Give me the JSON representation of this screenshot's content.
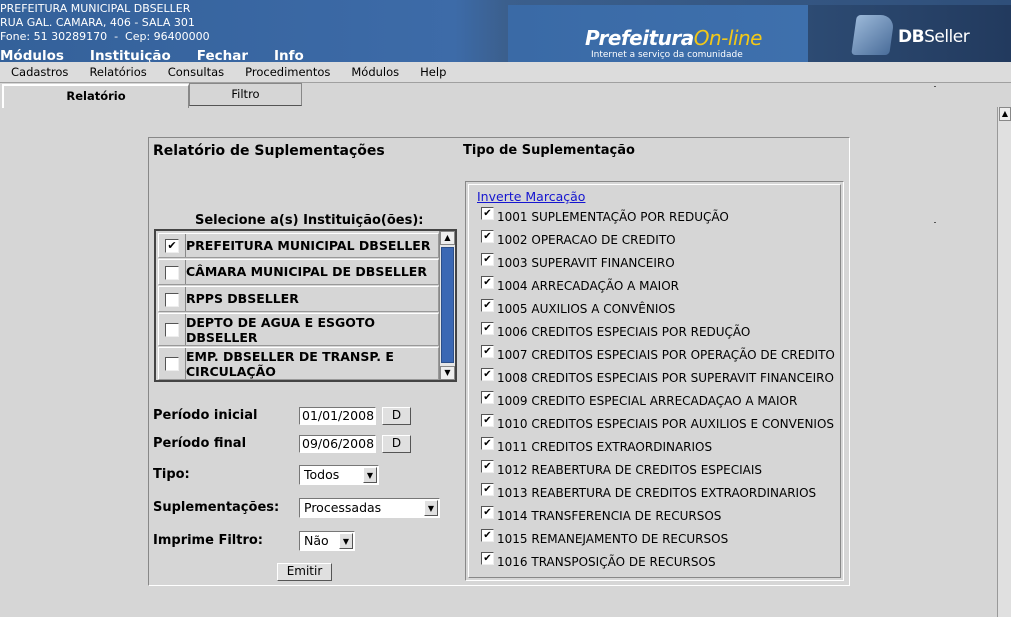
{
  "header": {
    "org_line1": "PREFEITURA MUNICIPAL DBSELLER",
    "org_line2": "RUA GAL. CAMARA, 406 - SALA 301",
    "org_line3": "Fone: 51 30289170  -  Cep: 96400000",
    "top_menu": [
      "Módulos",
      "Instituição",
      "Fechar",
      "Info"
    ],
    "brand_prefeitura": "Prefeitura",
    "brand_online": "On-line",
    "brand_tagline": "Internet a serviço da comunidade",
    "db_logo_bold": "DB",
    "db_logo_rest": "Seller"
  },
  "menubar": [
    "Cadastros",
    "Relatórios",
    "Consultas",
    "Procedimentos",
    "Módulos",
    "Help"
  ],
  "tabs": {
    "relatorio": "Relatório",
    "filtro": "Filtro"
  },
  "form": {
    "title": "Relatório de Suplementações",
    "institutions_label": "Selecione a(s) Instituição(ões):",
    "institutions": [
      {
        "name": "PREFEITURA MUNICIPAL DBSELLER",
        "checked": true
      },
      {
        "name": "CÂMARA MUNICIPAL DE DBSELLER",
        "checked": false
      },
      {
        "name": "RPPS DBSELLER",
        "checked": false
      },
      {
        "name": "DEPTO DE AGUA E ESGOTO DBSELLER",
        "checked": false
      },
      {
        "name": "EMP. DBSELLER DE TRANSP. E CIRCULAÇÃO",
        "checked": false
      }
    ],
    "periodo_inicial_label": "Período inicial",
    "periodo_inicial_value": "01/01/2008",
    "periodo_final_label": "Período final",
    "periodo_final_value": "09/06/2008",
    "date_button": "D",
    "tipo_label": "Tipo:",
    "tipo_value": "Todos",
    "suplementacoes_label": "Suplementações:",
    "suplementacoes_value": "Processadas",
    "imprime_filtro_label": "Imprime Filtro:",
    "imprime_filtro_value": "Não",
    "emitir_button": "Emitir"
  },
  "tipo_suplementacao": {
    "title": "Tipo de Suplementação",
    "invert_link": "Inverte Marcação",
    "items": [
      {
        "code": "1001",
        "label": "SUPLEMENTAÇÃO POR REDUÇÃO",
        "checked": true
      },
      {
        "code": "1002",
        "label": "OPERACAO DE CREDITO",
        "checked": true
      },
      {
        "code": "1003",
        "label": "SUPERAVIT FINANCEIRO",
        "checked": true
      },
      {
        "code": "1004",
        "label": "ARRECADAÇÃO A MAIOR",
        "checked": true
      },
      {
        "code": "1005",
        "label": "AUXILIOS A CONVÊNIOS",
        "checked": true
      },
      {
        "code": "1006",
        "label": "CREDITOS ESPECIAIS POR REDUÇÃO",
        "checked": true
      },
      {
        "code": "1007",
        "label": "CREDITOS ESPECIAIS POR OPERAÇÃO DE CREDITO",
        "checked": true
      },
      {
        "code": "1008",
        "label": "CREDITOS ESPECIAIS POR SUPERAVIT FINANCEIRO",
        "checked": true
      },
      {
        "code": "1009",
        "label": "CREDITO ESPECIAL ARRECADAÇAO A MAIOR",
        "checked": true
      },
      {
        "code": "1010",
        "label": "CREDITOS ESPECIAIS POR AUXILIOS E CONVENIOS",
        "checked": true
      },
      {
        "code": "1011",
        "label": "CREDITOS EXTRAORDINARIOS",
        "checked": true
      },
      {
        "code": "1012",
        "label": "REABERTURA DE CREDITOS ESPECIAIS",
        "checked": true
      },
      {
        "code": "1013",
        "label": "REABERTURA DE CREDITOS EXTRAORDINARIOS",
        "checked": true
      },
      {
        "code": "1014",
        "label": "TRANSFERENCIA DE RECURSOS",
        "checked": true
      },
      {
        "code": "1015",
        "label": "REMANEJAMENTO DE RECURSOS",
        "checked": true
      },
      {
        "code": "1016",
        "label": "TRANSPOSIÇÃO DE RECURSOS",
        "checked": true
      }
    ]
  },
  "icons": {
    "checkmark": "✔",
    "arrow_up": "▲",
    "arrow_down": "▼"
  }
}
